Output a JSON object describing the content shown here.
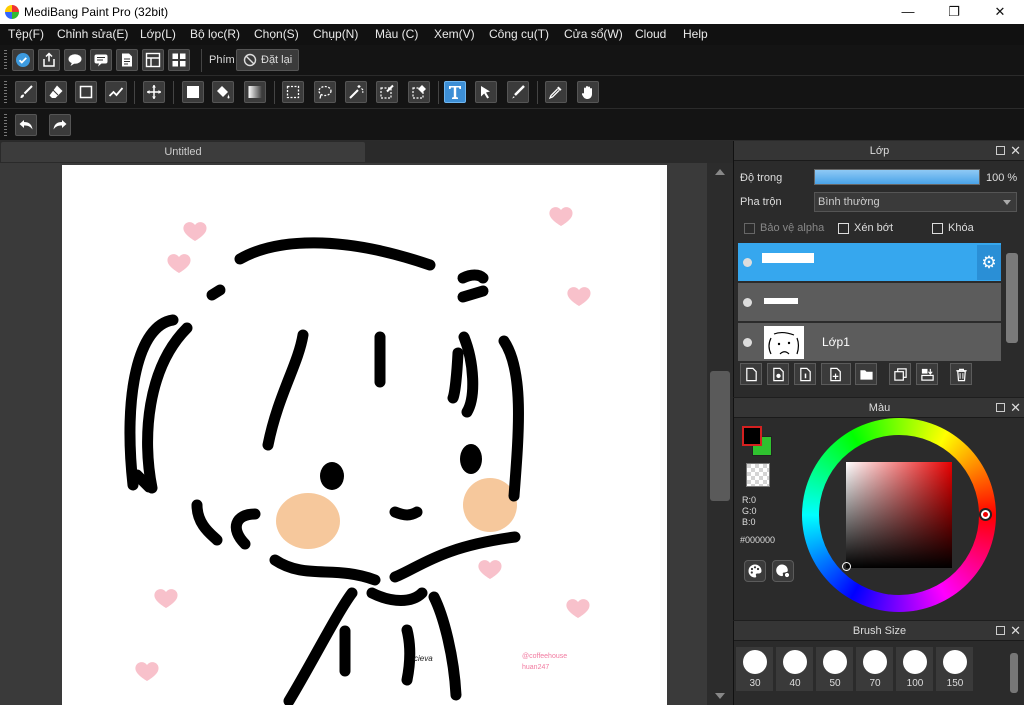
{
  "window": {
    "title": "MediBang Paint Pro (32bit)",
    "minimize_glyph": "—",
    "maximize_glyph": "❐",
    "close_glyph": "✕"
  },
  "menu": [
    "Tệp(F)",
    "Chỉnh sửa(E)",
    "Lớp(L)",
    "Bộ lọc(R)",
    "Chọn(S)",
    "Chụp(N)",
    "Màu (C)",
    "Xem(V)",
    "Công cụ(T)",
    "Cửa sổ(W)",
    "Cloud",
    "Help"
  ],
  "toolbar1": {
    "shortcut_label": "Phím",
    "reset_label": "Đặt lại"
  },
  "toolbar2": {
    "tools": [
      "brush-tool",
      "eraser-tool",
      "dot-tool",
      "grad-line-tool",
      "move-tool",
      "fill-rect-tool",
      "bucket-tool",
      "gradation-tool",
      "select-tool",
      "lasso-tool",
      "magic-wand-tool",
      "selection-pen-tool",
      "selection-eraser-tool",
      "text-tool",
      "operation-tool",
      "divide-tool",
      "eyedropper-tool",
      "hand-tool"
    ],
    "active_tool": "text-tool"
  },
  "document": {
    "tab_title": "Untitled",
    "signature": "cieva",
    "watermark_line1": "@coffeehouse",
    "watermark_line2": "huan247"
  },
  "layer_panel": {
    "title": "Lớp",
    "opacity_label": "Độ trong",
    "opacity_value": "100 %",
    "opacity_fraction": 1.0,
    "blend_label": "Pha trộn",
    "blend_value": "Bình thường",
    "protect_alpha_label": "Bảo vệ alpha",
    "clipping_label": "Xén bớt",
    "lock_label": "Khóa",
    "layers": [
      {
        "name": "",
        "selected": true
      },
      {
        "name": "",
        "selected": false
      },
      {
        "name": "Lớp1",
        "selected": false
      }
    ]
  },
  "color_panel": {
    "title": "Màu",
    "r": "R:0",
    "g": "G:0",
    "b": "B:0",
    "hex": "#000000",
    "foreground": "#000000",
    "background": "#2fc22f"
  },
  "brush_panel": {
    "title": "Brush Size",
    "sizes": [
      "30",
      "40",
      "50",
      "70",
      "100",
      "150"
    ]
  }
}
